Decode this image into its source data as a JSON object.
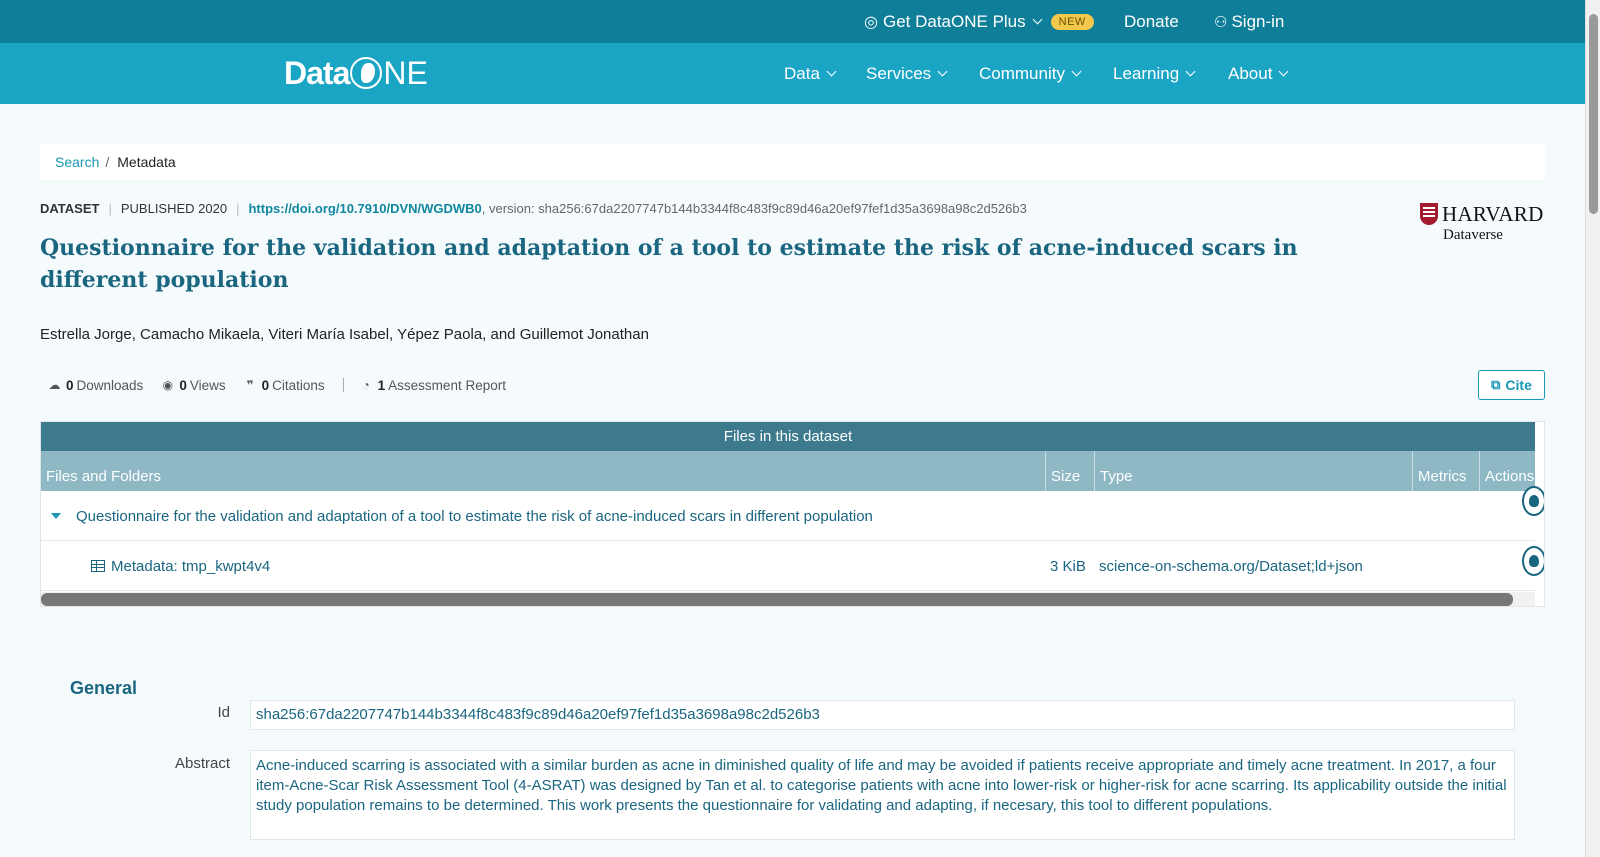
{
  "topbar": {
    "plus_label": "Get DataONE Plus",
    "new_badge": "NEW",
    "donate": "Donate",
    "signin": "Sign-in"
  },
  "navbar": {
    "logo_data": "Data",
    "logo_ne": "NE",
    "items": [
      "Data",
      "Services",
      "Community",
      "Learning",
      "About"
    ]
  },
  "breadcrumb": {
    "search": "Search",
    "current": "Metadata"
  },
  "dataset": {
    "kind": "DATASET",
    "published": "PUBLISHED 2020",
    "doi": "https://doi.org/10.7910/DVN/WGDWB0",
    "version": ", version: sha256:67da2207747b144b3344f8c483f9c89d46a20ef97fef1d35a3698a98c2d526b3",
    "title": "Questionnaire for the validation and adaptation of a tool to estimate the risk of acne-induced scars in different population",
    "authors": "Estrella Jorge, Camacho Mikaela, Viteri María Isabel, Yépez Paola, and Guillemot Jonathan",
    "repository_line1": "HARVARD",
    "repository_line2": "Dataverse"
  },
  "stats": {
    "downloads_count": "0",
    "downloads_label": "Downloads",
    "views_count": "0",
    "views_label": "Views",
    "citations_count": "0",
    "citations_label": "Citations",
    "assessment_count": "1",
    "assessment_label": "Assessment Report"
  },
  "cite_label": "Cite",
  "files": {
    "header": "Files in this dataset",
    "columns": [
      "Files and Folders",
      "Size",
      "Type",
      "Metrics",
      "Actions"
    ],
    "package_name": "Questionnaire for the validation and adaptation of a tool to estimate the risk of acne-induced scars in different population",
    "metadata_name": "Metadata: tmp_kwpt4v4",
    "metadata_size": "3 KiB",
    "metadata_type": "science-on-schema.org/Dataset;ld+json"
  },
  "general": {
    "heading": "General",
    "id_label": "Id",
    "id_value": "sha256:67da2207747b144b3344f8c483f9c89d46a20ef97fef1d35a3698a98c2d526b3",
    "abstract_label": "Abstract",
    "abstract_value": "Acne-induced scarring is associated with a similar burden as acne in diminished quality of life and may be avoided if patients receive appropriate and timely acne treatment. In 2017, a four item-Acne-Scar Risk Assessment Tool (4-ASRAT) was designed by Tan et al. to categorise patients with acne into lower-risk or higher-risk for acne scarring. Its applicability outside the initial study population remains to be determined. This work presents the questionnaire for validating and adapting, if necesary, this tool to different populations."
  },
  "colors": {
    "topbar": "#0f7f99",
    "navbar": "#1aa5c4",
    "title": "#1a6680",
    "table_header": "#3d7a8e",
    "table_cols": "#8fb8c5"
  }
}
